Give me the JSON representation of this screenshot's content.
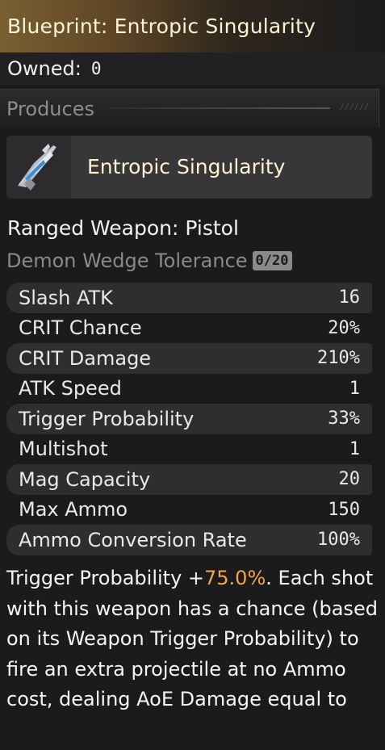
{
  "header": {
    "title": "Blueprint: Entropic Singularity"
  },
  "owned": {
    "label": "Owned:",
    "value": "0"
  },
  "produces": {
    "label": "Produces",
    "deco": "//////"
  },
  "product": {
    "name": "Entropic Singularity",
    "icon": "pistol-weapon-icon"
  },
  "weapon_type": "Ranged Weapon:  Pistol",
  "tolerance": {
    "label": "Demon Wedge Tolerance",
    "value": "0/20"
  },
  "stats": [
    {
      "label": "Slash ATK",
      "value": "16"
    },
    {
      "label": "CRIT Chance",
      "value": "20%"
    },
    {
      "label": "CRIT Damage",
      "value": "210%"
    },
    {
      "label": "ATK Speed",
      "value": "1"
    },
    {
      "label": "Trigger Probability",
      "value": "33%"
    },
    {
      "label": "Multishot",
      "value": "1"
    },
    {
      "label": "Mag Capacity",
      "value": "20"
    },
    {
      "label": "Max Ammo",
      "value": "150"
    },
    {
      "label": "Ammo Conversion Rate",
      "value": "100%"
    }
  ],
  "description": {
    "before": "Trigger Probability +",
    "highlight": "75.0%",
    "after": ". Each shot with this weapon has a chance (based on its Weapon Trigger Probability) to fire an extra projectile at no Ammo cost, dealing AoE Damage equal to"
  },
  "colors": {
    "accent": "#f3a54a",
    "title_gold": "#7a5f33"
  }
}
